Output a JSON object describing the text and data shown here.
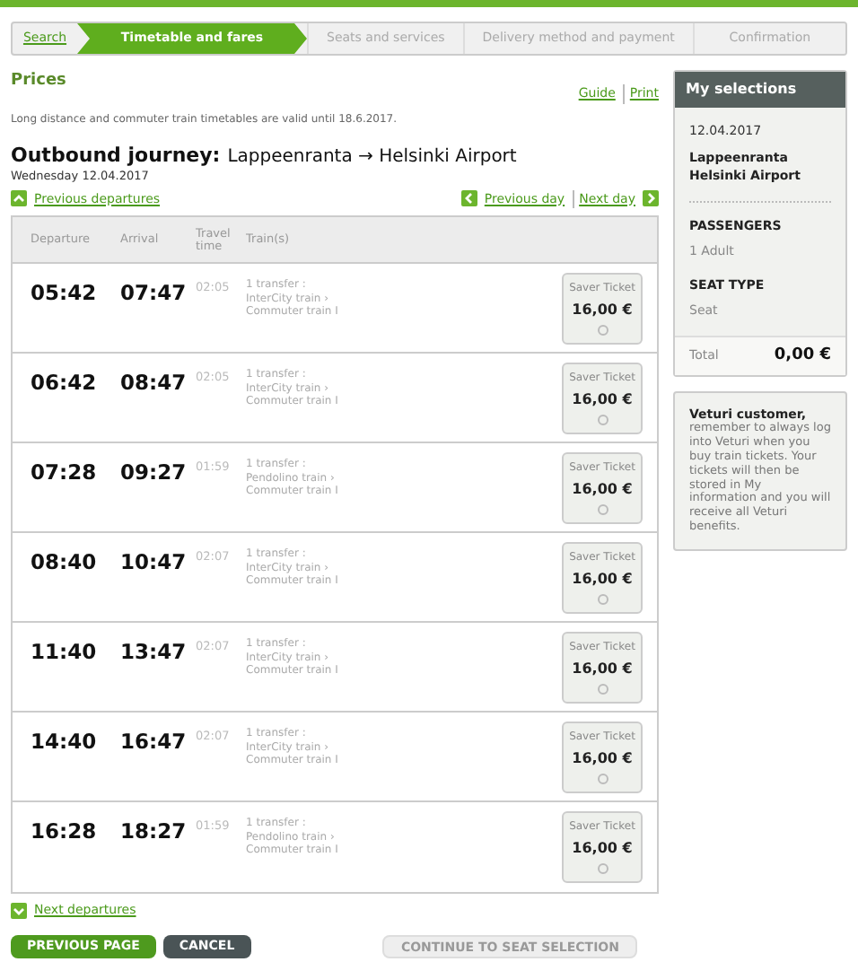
{
  "steps": [
    {
      "label": "Search",
      "completed": true,
      "selected": false
    },
    {
      "label": "Timetable and fares",
      "completed": false,
      "selected": true
    },
    {
      "label": "Seats and services",
      "completed": false,
      "selected": false
    },
    {
      "label": "Delivery method and payment",
      "completed": false,
      "selected": false
    },
    {
      "label": "Confirmation",
      "completed": false,
      "selected": false
    }
  ],
  "prices": {
    "title": "Prices",
    "links": [
      "Guide",
      "Print"
    ],
    "notice": "Long distance and commuter train timetables are valid until 18.6.2017."
  },
  "journey": {
    "label": "Outbound journey:",
    "route": "Lappeenranta → Helsinki Airport",
    "date": "Wednesday 12.04.2017"
  },
  "nav": {
    "previous_departures": "Previous departures",
    "previous_day": "Previous day",
    "next_day": "Next day",
    "next_departures": "Next departures"
  },
  "table": {
    "columns": [
      "Departure",
      "Arrival",
      "Travel time",
      "Train(s)"
    ],
    "rows": [
      {
        "departure": "05:42",
        "arrival": "07:47",
        "duration": "02:05",
        "trains": [
          "1 transfer :",
          "InterCity train ›",
          "Commuter train I"
        ],
        "fare": {
          "name": "Saver Ticket",
          "price": "16,00 €",
          "selected": false
        }
      },
      {
        "departure": "06:42",
        "arrival": "08:47",
        "duration": "02:05",
        "trains": [
          "1 transfer :",
          "InterCity train ›",
          "Commuter train I"
        ],
        "fare": {
          "name": "Saver Ticket",
          "price": "16,00 €",
          "selected": false
        }
      },
      {
        "departure": "07:28",
        "arrival": "09:27",
        "duration": "01:59",
        "trains": [
          "1 transfer :",
          "Pendolino train ›",
          "Commuter train I"
        ],
        "fare": {
          "name": "Saver Ticket",
          "price": "16,00 €",
          "selected": false
        }
      },
      {
        "departure": "08:40",
        "arrival": "10:47",
        "duration": "02:07",
        "trains": [
          "1 transfer :",
          "InterCity train ›",
          "Commuter train I"
        ],
        "fare": {
          "name": "Saver Ticket",
          "price": "16,00 €",
          "selected": false
        }
      },
      {
        "departure": "11:40",
        "arrival": "13:47",
        "duration": "02:07",
        "trains": [
          "1 transfer :",
          "InterCity train ›",
          "Commuter train I"
        ],
        "fare": {
          "name": "Saver Ticket",
          "price": "16,00 €",
          "selected": false
        }
      },
      {
        "departure": "14:40",
        "arrival": "16:47",
        "duration": "02:07",
        "trains": [
          "1 transfer :",
          "InterCity train ›",
          "Commuter train I"
        ],
        "fare": {
          "name": "Saver Ticket",
          "price": "16,00 €",
          "selected": false
        }
      },
      {
        "departure": "16:28",
        "arrival": "18:27",
        "duration": "01:59",
        "trains": [
          "1 transfer :",
          "Pendolino train ›",
          "Commuter train I"
        ],
        "fare": {
          "name": "Saver Ticket",
          "price": "16,00 €",
          "selected": false
        }
      }
    ]
  },
  "buttons": [
    {
      "label": "PREVIOUS PAGE",
      "kind": "back",
      "disabled": false
    },
    {
      "label": "CANCEL",
      "kind": "cancel",
      "disabled": false
    },
    {
      "label": "CONTINUE TO SEAT SELECTION",
      "kind": "forward",
      "disabled": true
    }
  ],
  "sidebar": {
    "title": "My selections",
    "date": "12.04.2017",
    "from": "Lappeenranta",
    "to": "Helsinki Airport",
    "sections": [
      {
        "heading": "PASSENGERS",
        "value": "1 Adult"
      },
      {
        "heading": "SEAT TYPE",
        "value": "Seat"
      }
    ],
    "total_label": "Total",
    "total": "0,00 €",
    "info_title": "Veturi customer,",
    "info_text": "remember to always log into Veturi when you buy train tickets. Your tickets will then be stored in My information and you will receive all Veturi benefits."
  }
}
